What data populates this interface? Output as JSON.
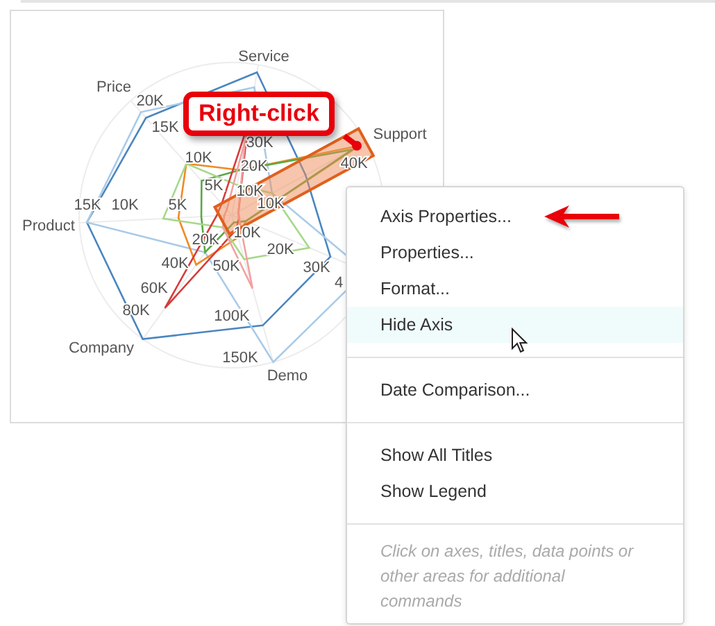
{
  "chart": {
    "axes": [
      {
        "name": "Price",
        "ticks": [
          "20K",
          "15K",
          "10K",
          "5K"
        ]
      },
      {
        "name": "Service",
        "ticks": [
          "30K",
          "20K",
          "10K"
        ]
      },
      {
        "name": "Support",
        "ticks": [
          "40K",
          "10K"
        ]
      },
      {
        "name": "Product",
        "ticks": [
          "15K",
          "10K",
          "5K"
        ]
      },
      {
        "name": "Company",
        "ticks": [
          "20K",
          "40K",
          "60K",
          "80K"
        ]
      },
      {
        "ticks": [
          "10K",
          "20K",
          "30K",
          "4"
        ]
      },
      {
        "name": "Demo",
        "ticks": [
          "50K",
          "100K",
          "150K"
        ]
      }
    ],
    "callout": {
      "text": "Right-click"
    }
  },
  "context_menu": {
    "groups": [
      [
        {
          "label": "Axis Properties...",
          "selected": false
        },
        {
          "label": "Properties...",
          "selected": false
        },
        {
          "label": "Format...",
          "selected": false
        },
        {
          "label": "Hide Axis",
          "selected": true
        }
      ],
      [
        {
          "label": "Date Comparison...",
          "selected": false
        }
      ],
      [
        {
          "label": "Show All Titles",
          "selected": false
        },
        {
          "label": "Show Legend",
          "selected": false
        }
      ]
    ],
    "hint": "Click on axes, titles, data points or other areas for additional commands"
  }
}
